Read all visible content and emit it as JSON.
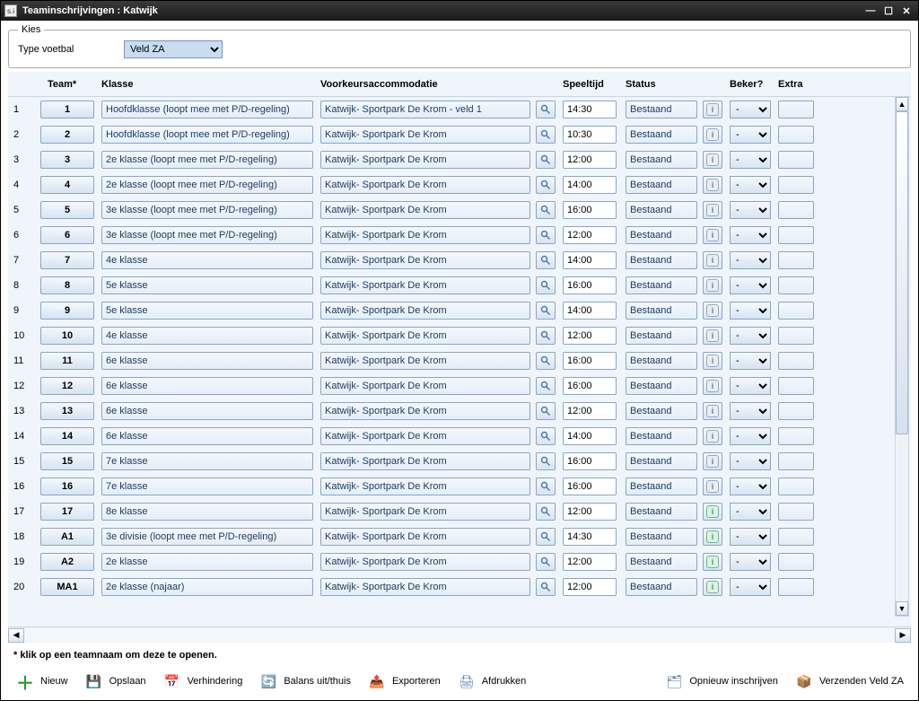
{
  "window": {
    "title": "Teaminschrijvingen : Katwijk",
    "icon": "s.i"
  },
  "kies": {
    "legend": "Kies",
    "type_label": "Type voetbal",
    "selected": "Veld ZA"
  },
  "headers": {
    "team": "Team*",
    "klasse": "Klasse",
    "accom": "Voorkeursaccommodatie",
    "speeltijd": "Speeltijd",
    "status": "Status",
    "beker": "Beker?",
    "extra": "Extra"
  },
  "bekerDefault": "-",
  "rows": [
    {
      "num": "1",
      "team": "1",
      "klasse": "Hoofdklasse (loopt mee met P/D-regeling)",
      "accom": "Katwijk- Sportpark De Krom - veld 1",
      "speeltijd": "14:30",
      "status": "Bestaand",
      "infoActive": false
    },
    {
      "num": "2",
      "team": "2",
      "klasse": "Hoofdklasse (loopt mee met P/D-regeling)",
      "accom": "Katwijk- Sportpark De Krom",
      "speeltijd": "10:30",
      "status": "Bestaand",
      "infoActive": false
    },
    {
      "num": "3",
      "team": "3",
      "klasse": "2e klasse (loopt mee met P/D-regeling)",
      "accom": "Katwijk- Sportpark De Krom",
      "speeltijd": "12:00",
      "status": "Bestaand",
      "infoActive": false
    },
    {
      "num": "4",
      "team": "4",
      "klasse": "2e klasse (loopt mee met P/D-regeling)",
      "accom": "Katwijk- Sportpark De Krom",
      "speeltijd": "14:00",
      "status": "Bestaand",
      "infoActive": false
    },
    {
      "num": "5",
      "team": "5",
      "klasse": "3e klasse (loopt mee met P/D-regeling)",
      "accom": "Katwijk- Sportpark De Krom",
      "speeltijd": "16:00",
      "status": "Bestaand",
      "infoActive": false
    },
    {
      "num": "6",
      "team": "6",
      "klasse": "3e klasse (loopt mee met P/D-regeling)",
      "accom": "Katwijk- Sportpark De Krom",
      "speeltijd": "12:00",
      "status": "Bestaand",
      "infoActive": false
    },
    {
      "num": "7",
      "team": "7",
      "klasse": "4e klasse",
      "accom": "Katwijk- Sportpark De Krom",
      "speeltijd": "14:00",
      "status": "Bestaand",
      "infoActive": false
    },
    {
      "num": "8",
      "team": "8",
      "klasse": "5e klasse",
      "accom": "Katwijk- Sportpark De Krom",
      "speeltijd": "16:00",
      "status": "Bestaand",
      "infoActive": false
    },
    {
      "num": "9",
      "team": "9",
      "klasse": "5e klasse",
      "accom": "Katwijk- Sportpark De Krom",
      "speeltijd": "14:00",
      "status": "Bestaand",
      "infoActive": false
    },
    {
      "num": "10",
      "team": "10",
      "klasse": "4e klasse",
      "accom": "Katwijk- Sportpark De Krom",
      "speeltijd": "12:00",
      "status": "Bestaand",
      "infoActive": false
    },
    {
      "num": "11",
      "team": "11",
      "klasse": "6e klasse",
      "accom": "Katwijk- Sportpark De Krom",
      "speeltijd": "16:00",
      "status": "Bestaand",
      "infoActive": false
    },
    {
      "num": "12",
      "team": "12",
      "klasse": "6e klasse",
      "accom": "Katwijk- Sportpark De Krom",
      "speeltijd": "16:00",
      "status": "Bestaand",
      "infoActive": false
    },
    {
      "num": "13",
      "team": "13",
      "klasse": "6e klasse",
      "accom": "Katwijk- Sportpark De Krom",
      "speeltijd": "12:00",
      "status": "Bestaand",
      "infoActive": false
    },
    {
      "num": "14",
      "team": "14",
      "klasse": "6e klasse",
      "accom": "Katwijk- Sportpark De Krom",
      "speeltijd": "14:00",
      "status": "Bestaand",
      "infoActive": false
    },
    {
      "num": "15",
      "team": "15",
      "klasse": "7e klasse",
      "accom": "Katwijk- Sportpark De Krom",
      "speeltijd": "16:00",
      "status": "Bestaand",
      "infoActive": false
    },
    {
      "num": "16",
      "team": "16",
      "klasse": "7e klasse",
      "accom": "Katwijk- Sportpark De Krom",
      "speeltijd": "16:00",
      "status": "Bestaand",
      "infoActive": false
    },
    {
      "num": "17",
      "team": "17",
      "klasse": "8e klasse",
      "accom": "Katwijk- Sportpark De Krom",
      "speeltijd": "12:00",
      "status": "Bestaand",
      "infoActive": true
    },
    {
      "num": "18",
      "team": "A1",
      "klasse": "3e divisie (loopt mee met P/D-regeling)",
      "accom": "Katwijk- Sportpark De Krom",
      "speeltijd": "14:30",
      "status": "Bestaand",
      "infoActive": true
    },
    {
      "num": "19",
      "team": "A2",
      "klasse": "2e klasse",
      "accom": "Katwijk- Sportpark De Krom",
      "speeltijd": "12:00",
      "status": "Bestaand",
      "infoActive": true
    },
    {
      "num": "20",
      "team": "MA1",
      "klasse": "2e klasse (najaar)",
      "accom": "Katwijk- Sportpark De Krom",
      "speeltijd": "12:00",
      "status": "Bestaand",
      "infoActive": true
    }
  ],
  "footnote": "* klik op een teamnaam om deze te openen.",
  "toolbar": {
    "nieuw": "Nieuw",
    "opslaan": "Opslaan",
    "verhindering": "Verhindering",
    "balans": "Balans uit/thuis",
    "exporteren": "Exporteren",
    "afdrukken": "Afdrukken",
    "opnieuw": "Opnieuw inschrijven",
    "verzenden": "Verzenden Veld ZA"
  }
}
